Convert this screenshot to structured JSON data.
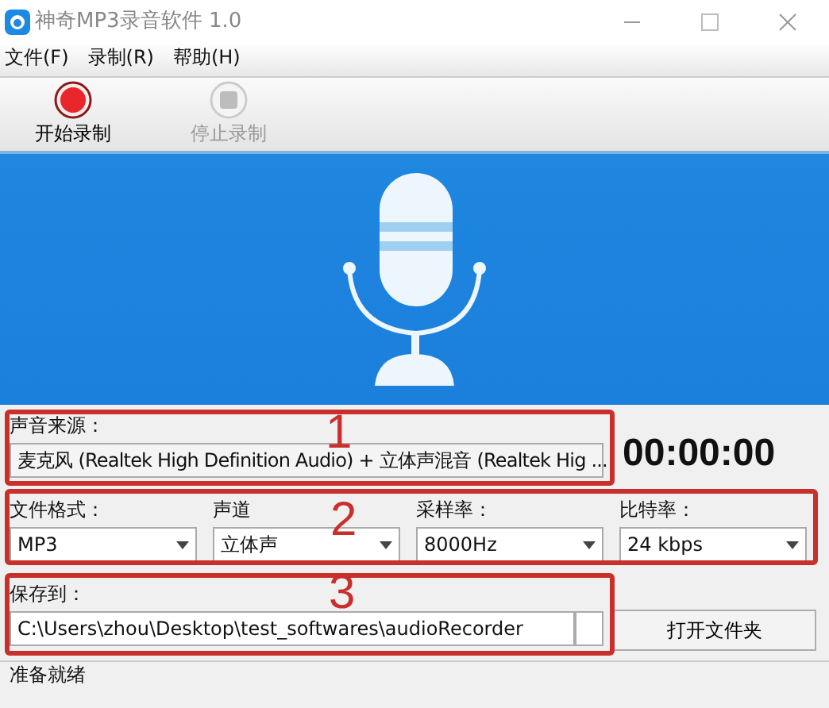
{
  "window": {
    "title": "神奇MP3录音软件 1.0"
  },
  "menu": [
    {
      "label": "文件(F)"
    },
    {
      "label": "录制(R)"
    },
    {
      "label": "帮助(H)"
    }
  ],
  "toolbar": [
    {
      "label": "开始录制",
      "kind": "record",
      "disabled": false
    },
    {
      "label": "停止录制",
      "kind": "stop",
      "disabled": true
    }
  ],
  "source": {
    "label": "声音来源：",
    "value": "麦克风 (Realtek High Definition Audio) + 立体声混音 (Realtek Hig ..."
  },
  "timer": "00:00:00",
  "settings": [
    {
      "label": "文件格式：",
      "value": "MP3"
    },
    {
      "label": "声道",
      "value": "立体声"
    },
    {
      "label": "采样率：",
      "value": "8000Hz"
    },
    {
      "label": "比特率：",
      "value": "24 kbps"
    }
  ],
  "save": {
    "label": "保存到：",
    "value": "C:\\Users\\zhou\\Desktop\\test_softwares\\audioRecorder",
    "button": "打开文件夹"
  },
  "status_bar": "准备就绪",
  "annotations": [
    {
      "label": "1"
    },
    {
      "label": "2"
    },
    {
      "label": "3"
    }
  ]
}
